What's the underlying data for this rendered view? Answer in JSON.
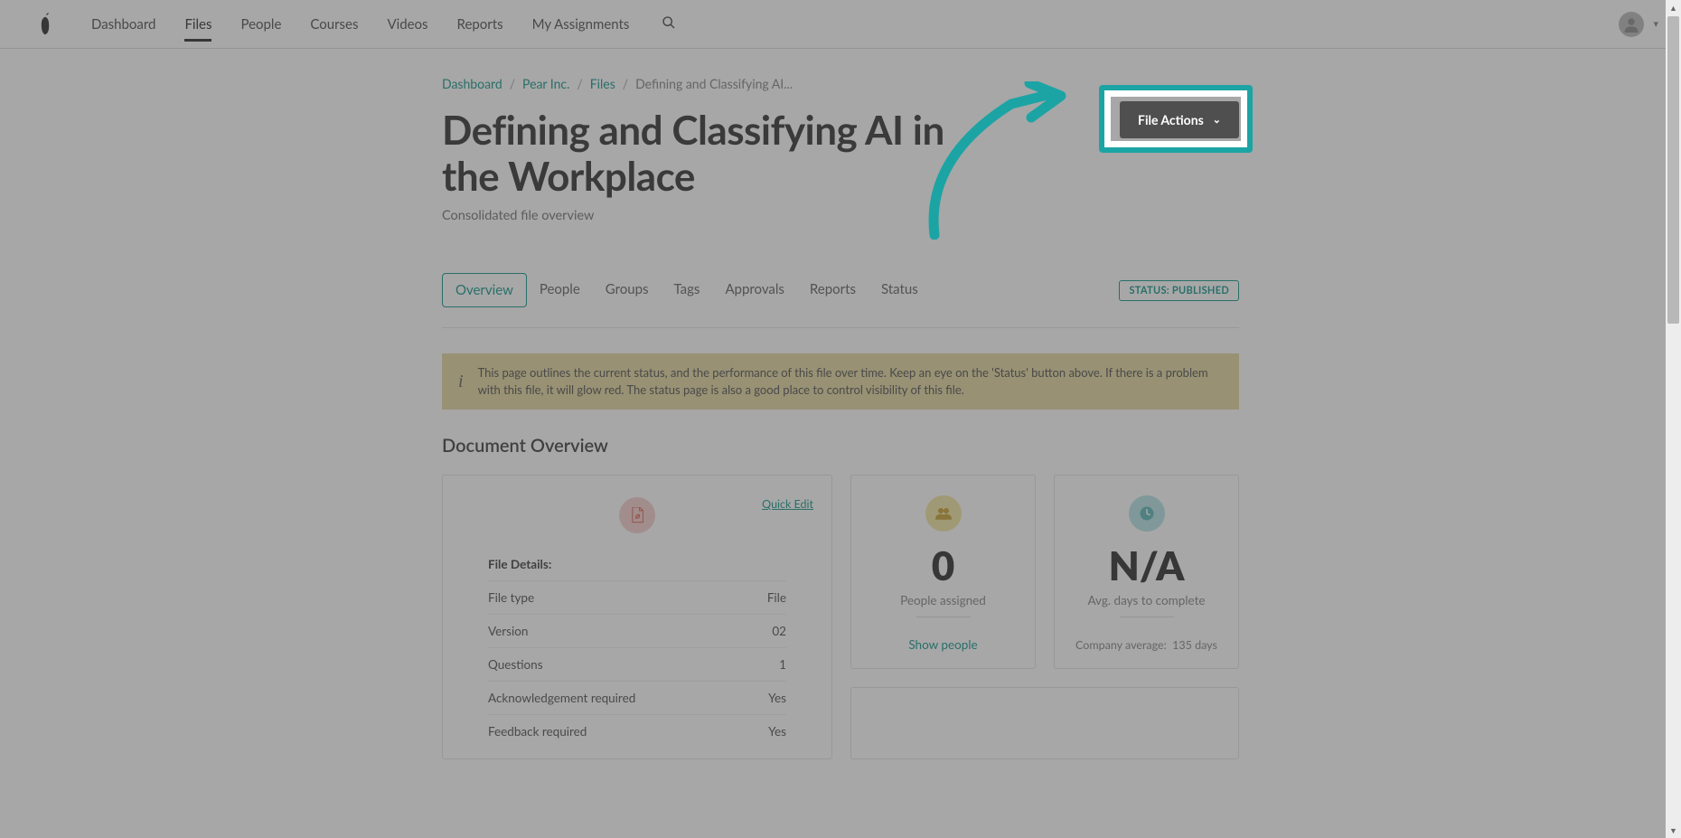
{
  "nav": {
    "items": [
      {
        "label": "Dashboard"
      },
      {
        "label": "Files"
      },
      {
        "label": "People"
      },
      {
        "label": "Courses"
      },
      {
        "label": "Videos"
      },
      {
        "label": "Reports"
      },
      {
        "label": "My Assignments"
      }
    ],
    "active_index": 1
  },
  "breadcrumb": {
    "items": [
      "Dashboard",
      "Pear Inc.",
      "Files"
    ],
    "current": "Defining and Classifying AI..."
  },
  "page": {
    "title": "Defining and Classifying AI in the Workplace",
    "subtitle": "Consolidated file overview"
  },
  "file_actions_label": "File Actions",
  "content_tabs": [
    {
      "label": "Overview"
    },
    {
      "label": "People"
    },
    {
      "label": "Groups"
    },
    {
      "label": "Tags"
    },
    {
      "label": "Approvals"
    },
    {
      "label": "Reports"
    },
    {
      "label": "Status"
    }
  ],
  "content_tabs_active_index": 0,
  "status_badge": "STATUS: PUBLISHED",
  "info_banner": "This page outlines the current status, and the performance of this file over time. Keep an eye on the 'Status' button above. If there is a problem with this file, it will glow red. The status page is also a good place to control visibility of this file.",
  "section_heading": "Document Overview",
  "quick_edit_label": "Quick Edit",
  "file_details": {
    "heading": "File Details:",
    "rows": [
      {
        "k": "File type",
        "v": "File"
      },
      {
        "k": "Version",
        "v": "02"
      },
      {
        "k": "Questions",
        "v": "1"
      },
      {
        "k": "Acknowledgement required",
        "v": "Yes"
      },
      {
        "k": "Feedback required",
        "v": "Yes"
      }
    ]
  },
  "stat_people": {
    "value": "0",
    "label": "People assigned",
    "link": "Show people"
  },
  "stat_avg": {
    "value": "N/A",
    "label": "Avg. days to complete",
    "footnote_prefix": "Company average:",
    "footnote_value": "135 days"
  },
  "colors": {
    "accent": "#1b9a8f",
    "highlight": "#1ca4a4"
  }
}
